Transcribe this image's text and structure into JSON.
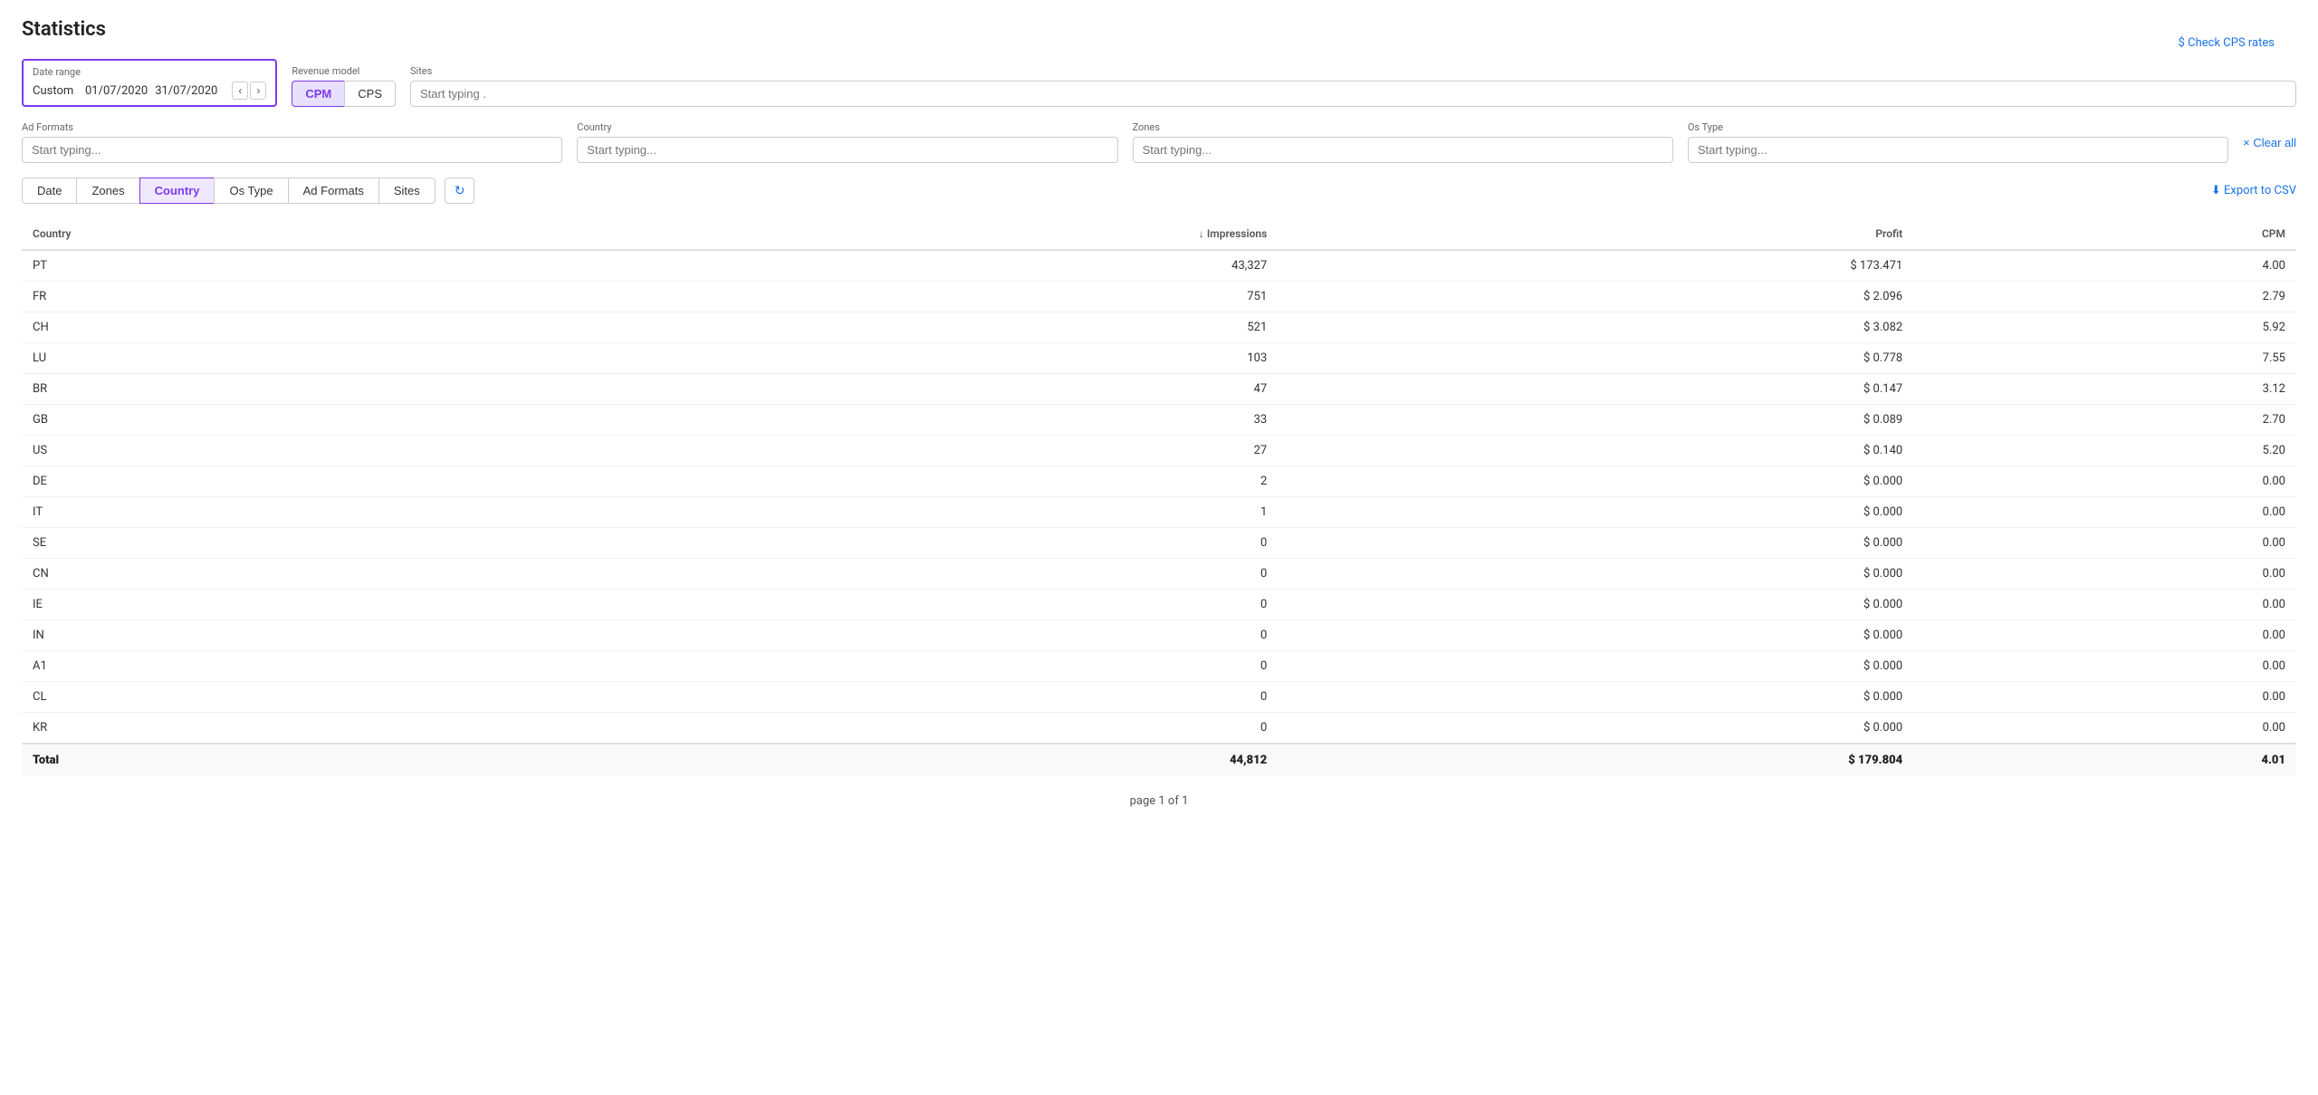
{
  "page": {
    "title": "Statistics",
    "check_cps_label": "$ Check CPS rates"
  },
  "filters": {
    "date_range": {
      "label": "Date range",
      "type": "Custom",
      "from": "01/07/2020",
      "to": "31/07/2020"
    },
    "revenue_model": {
      "label": "Revenue model",
      "options": [
        "CPM",
        "CPS"
      ],
      "active": "CPM"
    },
    "sites": {
      "label": "Sites",
      "placeholder": "Start typing ."
    },
    "ad_formats": {
      "label": "Ad Formats",
      "placeholder": "Start typing..."
    },
    "country": {
      "label": "Country",
      "placeholder": "Start typing..."
    },
    "zones": {
      "label": "Zones",
      "placeholder": "Start typing..."
    },
    "os_type": {
      "label": "Os Type",
      "placeholder": "Start typing..."
    },
    "clear_all_label": "× Clear all"
  },
  "tabs": [
    {
      "id": "date",
      "label": "Date"
    },
    {
      "id": "zones",
      "label": "Zones"
    },
    {
      "id": "country",
      "label": "Country",
      "active": true
    },
    {
      "id": "os-type",
      "label": "Os Type"
    },
    {
      "id": "ad-formats",
      "label": "Ad Formats"
    },
    {
      "id": "sites",
      "label": "Sites"
    }
  ],
  "export_label": "⬇ Export to CSV",
  "table": {
    "columns": [
      {
        "id": "country",
        "label": "Country",
        "align": "left"
      },
      {
        "id": "impressions",
        "label": "↓ Impressions",
        "align": "right"
      },
      {
        "id": "profit",
        "label": "Profit",
        "align": "right"
      },
      {
        "id": "cpm",
        "label": "CPM",
        "align": "right"
      }
    ],
    "rows": [
      {
        "country": "PT",
        "impressions": "43,327",
        "profit": "$ 173.471",
        "cpm": "4.00"
      },
      {
        "country": "FR",
        "impressions": "751",
        "profit": "$ 2.096",
        "cpm": "2.79"
      },
      {
        "country": "CH",
        "impressions": "521",
        "profit": "$ 3.082",
        "cpm": "5.92"
      },
      {
        "country": "LU",
        "impressions": "103",
        "profit": "$ 0.778",
        "cpm": "7.55"
      },
      {
        "country": "BR",
        "impressions": "47",
        "profit": "$ 0.147",
        "cpm": "3.12"
      },
      {
        "country": "GB",
        "impressions": "33",
        "profit": "$ 0.089",
        "cpm": "2.70"
      },
      {
        "country": "US",
        "impressions": "27",
        "profit": "$ 0.140",
        "cpm": "5.20"
      },
      {
        "country": "DE",
        "impressions": "2",
        "profit": "$ 0.000",
        "cpm": "0.00"
      },
      {
        "country": "IT",
        "impressions": "1",
        "profit": "$ 0.000",
        "cpm": "0.00"
      },
      {
        "country": "SE",
        "impressions": "0",
        "profit": "$ 0.000",
        "cpm": "0.00"
      },
      {
        "country": "CN",
        "impressions": "0",
        "profit": "$ 0.000",
        "cpm": "0.00"
      },
      {
        "country": "IE",
        "impressions": "0",
        "profit": "$ 0.000",
        "cpm": "0.00"
      },
      {
        "country": "IN",
        "impressions": "0",
        "profit": "$ 0.000",
        "cpm": "0.00"
      },
      {
        "country": "A1",
        "impressions": "0",
        "profit": "$ 0.000",
        "cpm": "0.00"
      },
      {
        "country": "CL",
        "impressions": "0",
        "profit": "$ 0.000",
        "cpm": "0.00"
      },
      {
        "country": "KR",
        "impressions": "0",
        "profit": "$ 0.000",
        "cpm": "0.00"
      }
    ],
    "total": {
      "label": "Total",
      "impressions": "44,812",
      "profit": "$ 179.804",
      "cpm": "4.01"
    }
  },
  "pagination": {
    "label": "page 1 of 1"
  }
}
